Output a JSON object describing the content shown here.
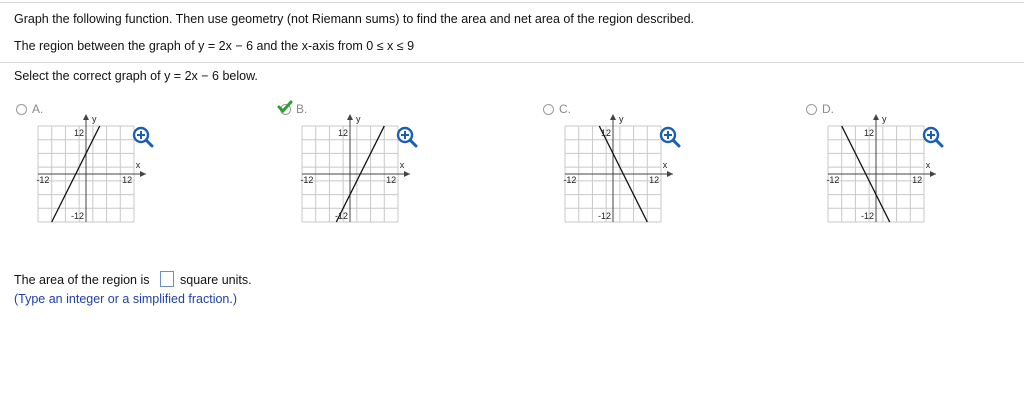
{
  "question": {
    "instruction": "Graph the following function. Then use geometry (not Riemann sums) to find the area and net area of the region described.",
    "region": "The region between the graph of y = 2x − 6 and the x-axis from 0 ≤ x ≤ 9",
    "select_prompt": "Select the correct graph of y = 2x − 6 below."
  },
  "options": [
    {
      "letter": "A.",
      "selected": false,
      "slope": 2,
      "intercept": 6
    },
    {
      "letter": "B.",
      "selected": true,
      "slope": 2,
      "intercept": -6
    },
    {
      "letter": "C.",
      "selected": false,
      "slope": -2,
      "intercept": 6
    },
    {
      "letter": "D.",
      "selected": false,
      "slope": -2,
      "intercept": -6
    }
  ],
  "graph_labels": {
    "y_axis": "y",
    "x_axis": "x",
    "max": "12",
    "neg_x": "-12",
    "pos_x": "12",
    "neg_y": "-12"
  },
  "answer": {
    "prefix": "The area of the region is",
    "suffix": "square units.",
    "hint": "(Type an integer or a simplified fraction.)"
  },
  "colors": {
    "check": "#2e9e2e",
    "zoom": "#1a5fb4",
    "hint": "#1f3fa8"
  },
  "icons": {
    "check": "check-icon",
    "zoom": "zoom-in-icon"
  }
}
